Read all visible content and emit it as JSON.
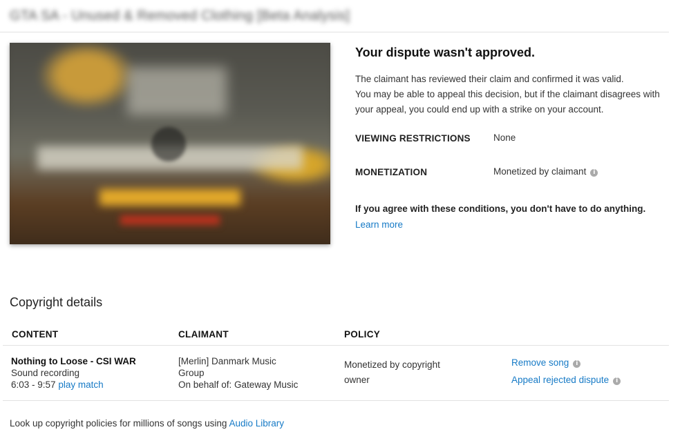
{
  "video": {
    "title": "GTA SA - Unused & Removed Clothing [Beta Analysis]"
  },
  "dispute": {
    "heading": "Your dispute wasn't approved.",
    "lines": [
      "The claimant has reviewed their claim and confirmed it was valid.",
      "You may be able to appeal this decision, but if the claimant disagrees with",
      "your appeal, you could end up with a strike on your account."
    ],
    "viewing_restrictions_label": "VIEWING RESTRICTIONS",
    "viewing_restrictions_value": "None",
    "monetization_label": "MONETIZATION",
    "monetization_value": "Monetized by claimant",
    "agree_text": "If you agree with these conditions, you don't have to do anything.",
    "learn_more": "Learn more"
  },
  "copyright": {
    "heading": "Copyright details",
    "columns": [
      "CONTENT",
      "CLAIMANT",
      "POLICY"
    ],
    "row": {
      "content_title": "Nothing to Loose - CSI WAR",
      "content_type": "Sound recording",
      "content_range": "6:03 - 9:57",
      "play_match": "play match",
      "claimant_line1": "[Merlin] Danmark Music",
      "claimant_line2": "Group",
      "claimant_line3": "On behalf of: Gateway Music",
      "policy_line1": "Monetized by copyright",
      "policy_line2": "owner",
      "action_remove": "Remove song",
      "action_appeal": "Appeal rejected dispute"
    }
  },
  "footer": {
    "text": "Look up copyright policies for millions of songs using",
    "link": "Audio Library"
  },
  "colors": {
    "link": "#167ac6",
    "divider": "#e2e2e2",
    "info_icon": "#aaaaaa"
  },
  "icons": [
    "play-icon",
    "info-icon"
  ]
}
